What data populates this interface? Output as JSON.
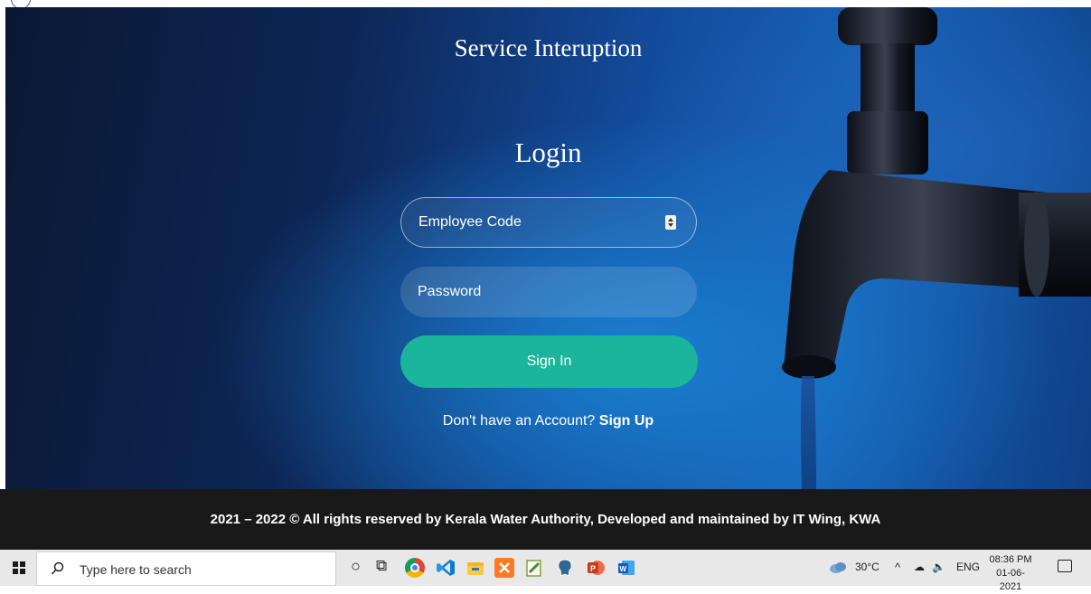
{
  "app": {
    "title": "Service Interuption"
  },
  "login": {
    "heading": "Login",
    "employee_code_label": "Employee Code",
    "password_placeholder": "Password",
    "signin_label": "Sign In",
    "signup_prompt": "Don't have an Account?",
    "signup_link": "Sign Up"
  },
  "footer": {
    "text": "2021 – 2022 © All rights reserved by Kerala Water Authority, Developed and maintained by IT Wing, KWA"
  },
  "taskbar": {
    "search_placeholder": "Type here to search",
    "apps": [
      "task-view",
      "chrome",
      "vscode",
      "file-explorer",
      "xampp",
      "notepad",
      "postgresql",
      "powerpoint",
      "word"
    ],
    "weather": "30°C",
    "language": "ENG",
    "time": "08:36 PM",
    "date": "01-06-2021"
  },
  "colors": {
    "accent": "#1ab59a",
    "footer_bg": "#191919",
    "hero_blue": "#1762b8"
  }
}
